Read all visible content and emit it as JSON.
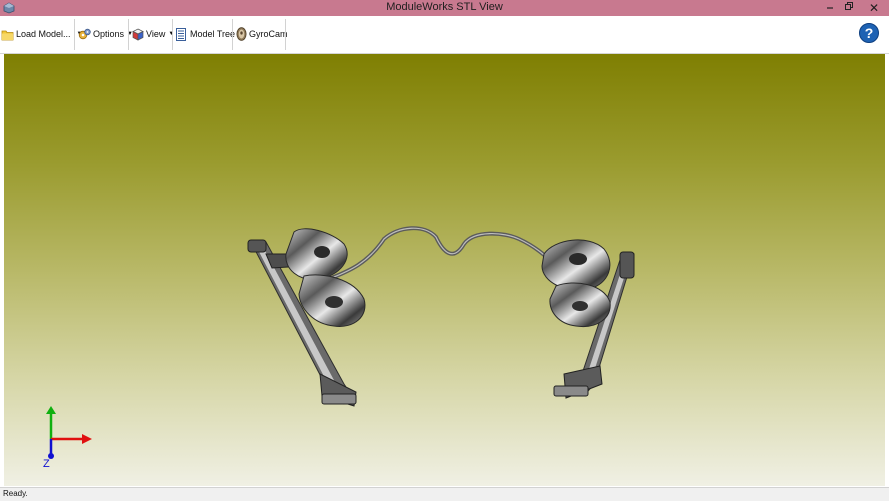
{
  "window": {
    "title": "ModuleWorks STL View",
    "minimize_icon": "minimize-icon",
    "restore_icon": "restore-icon",
    "close_glyph": "✕"
  },
  "toolbar": {
    "items": [
      {
        "label": "Load Model...",
        "icon": "folder-icon",
        "dropdown": true
      },
      {
        "label": "Options",
        "icon": "gears-icon",
        "dropdown": true
      },
      {
        "label": "View",
        "icon": "view-cube-icon",
        "dropdown": true
      },
      {
        "label": "Model Tree",
        "icon": "tree-list-icon",
        "dropdown": false
      },
      {
        "label": "GyroCam",
        "icon": "gyrocam-icon",
        "dropdown": false
      }
    ],
    "help_glyph": "?"
  },
  "viewport": {
    "background_top": "#7f7f02",
    "background_bottom": "#f0f0e4",
    "axis_z_label": "Z",
    "axis_colors": {
      "x": "#e01010",
      "y": "#10b010",
      "z": "#1010d0"
    }
  },
  "status": {
    "text": "Ready."
  }
}
